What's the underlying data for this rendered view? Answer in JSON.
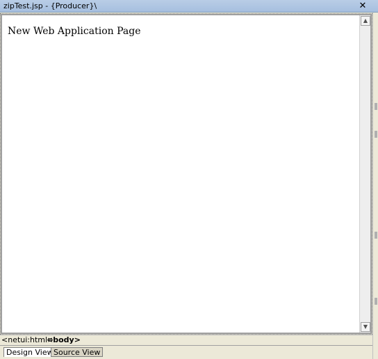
{
  "window": {
    "title": "zipTest.jsp - {Producer}\\"
  },
  "icons": {
    "close": "close-icon",
    "up": "scroll-up-arrow-icon",
    "down": "scroll-down-arrow-icon"
  },
  "canvas": {
    "heading": "New Web Application Page"
  },
  "breadcrumb": {
    "items": [
      "<netui:html>",
      "<body>"
    ]
  },
  "tabs": [
    {
      "label": "Design View",
      "active": true
    },
    {
      "label": "Source View",
      "active": false
    }
  ],
  "glyphs": {
    "close": "✕",
    "up": "▲",
    "down": "▼"
  }
}
